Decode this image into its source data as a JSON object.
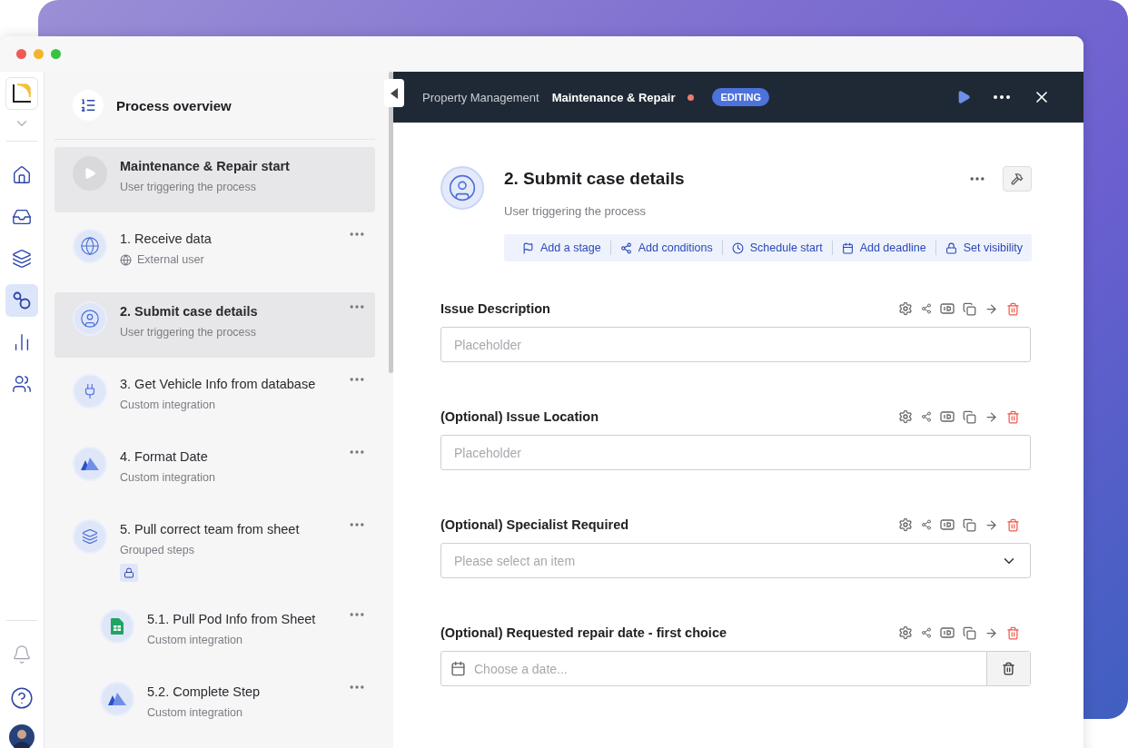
{
  "rail": {
    "items": [
      {
        "selected": false
      },
      {
        "selected": false
      },
      {
        "selected": false
      },
      {
        "selected": true
      },
      {
        "selected": false
      },
      {
        "selected": false
      }
    ]
  },
  "sidebar": {
    "title": "Process overview",
    "steps": [
      {
        "kind": "trigger",
        "title": "Maintenance & Repair start",
        "subtitle": "User triggering the process",
        "selected": true
      },
      {
        "kind": "step",
        "title": "1. Receive data",
        "subtitle": "External user",
        "selected": false
      },
      {
        "kind": "step",
        "title": "2. Submit case details",
        "subtitle": "User triggering the process",
        "selected": true
      },
      {
        "kind": "step",
        "title": "3. Get Vehicle Info from database",
        "subtitle": "Custom integration",
        "selected": false
      },
      {
        "kind": "step",
        "title": "4. Format Date",
        "subtitle": "Custom integration",
        "selected": false
      },
      {
        "kind": "group",
        "title": "5. Pull correct team from sheet",
        "subtitle": "Grouped steps",
        "locked": true,
        "selected": false,
        "children": [
          {
            "kind": "step",
            "title": "5.1. Pull Pod Info from Sheet",
            "subtitle": "Custom integration",
            "selected": false
          },
          {
            "kind": "step",
            "title": "5.2. Complete Step",
            "subtitle": "Custom integration",
            "selected": false
          }
        ]
      }
    ]
  },
  "header": {
    "breadcrumb": "Property Management",
    "process": "Maintenance & Repair",
    "unsaved": true,
    "badge": "EDITING"
  },
  "step": {
    "title": "2. Submit case details",
    "subtitle": "User triggering the process",
    "actions": [
      "Add a stage",
      "Add conditions",
      "Schedule start",
      "Add deadline",
      "Set visibility"
    ]
  },
  "fields": [
    {
      "kind": "text",
      "label": "Issue Description",
      "placeholder": "Placeholder"
    },
    {
      "kind": "text",
      "label": "(Optional) Issue Location",
      "placeholder": "Placeholder"
    },
    {
      "kind": "select",
      "label": "(Optional) Specialist Required",
      "placeholder": "Please select an item"
    },
    {
      "kind": "date",
      "label": "(Optional) Requested repair date - first choice",
      "placeholder": "Choose a date..."
    }
  ]
}
